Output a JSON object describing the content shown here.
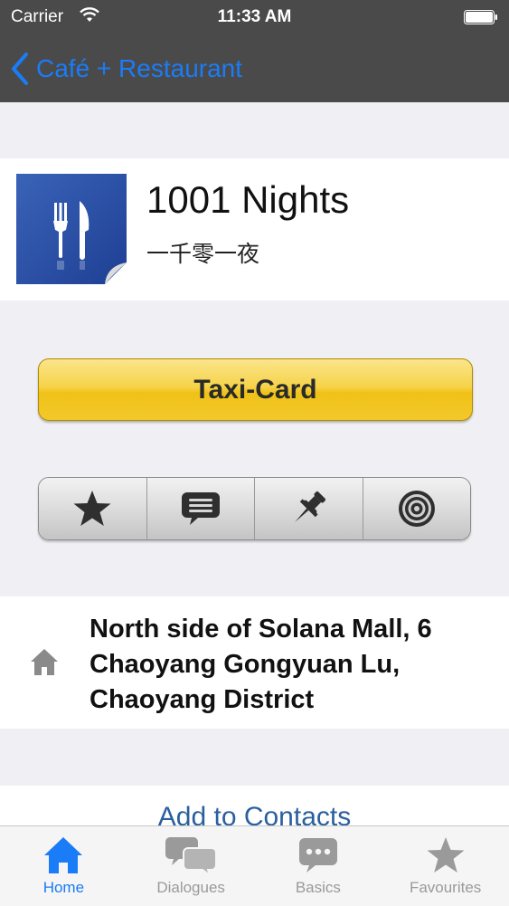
{
  "status_bar": {
    "carrier": "Carrier",
    "time": "11:33 AM"
  },
  "nav": {
    "back_label": "Café + Restaurant"
  },
  "restaurant": {
    "name": "1001 Nights",
    "chinese_name": "一千零一夜",
    "logo_icon": "fork-knife-icon"
  },
  "actions": {
    "taxi_card_label": "Taxi-Card",
    "segments": [
      {
        "icon": "star-icon"
      },
      {
        "icon": "speech-bubble-icon"
      },
      {
        "icon": "pushpin-icon"
      },
      {
        "icon": "target-icon"
      }
    ]
  },
  "address": {
    "icon": "home-icon",
    "line1": "North side of Solana Mall, 6",
    "line2": "Chaoyang Gongyuan Lu,",
    "line3": "Chaoyang District"
  },
  "contacts": {
    "add_label": "Add to Contacts"
  },
  "tab_bar": {
    "tabs": [
      {
        "label": "Home",
        "icon": "home-icon",
        "active": true
      },
      {
        "label": "Dialogues",
        "icon": "speech-bubbles-icon",
        "active": false
      },
      {
        "label": "Basics",
        "icon": "speech-bubble-icon",
        "active": false
      },
      {
        "label": "Favourites",
        "icon": "star-icon",
        "active": false
      }
    ]
  },
  "colors": {
    "accent": "#1a7cf7",
    "nav_background": "#4a4a4a",
    "taxi_yellow": "#f2c82a",
    "link_blue": "#2a5f9e"
  }
}
